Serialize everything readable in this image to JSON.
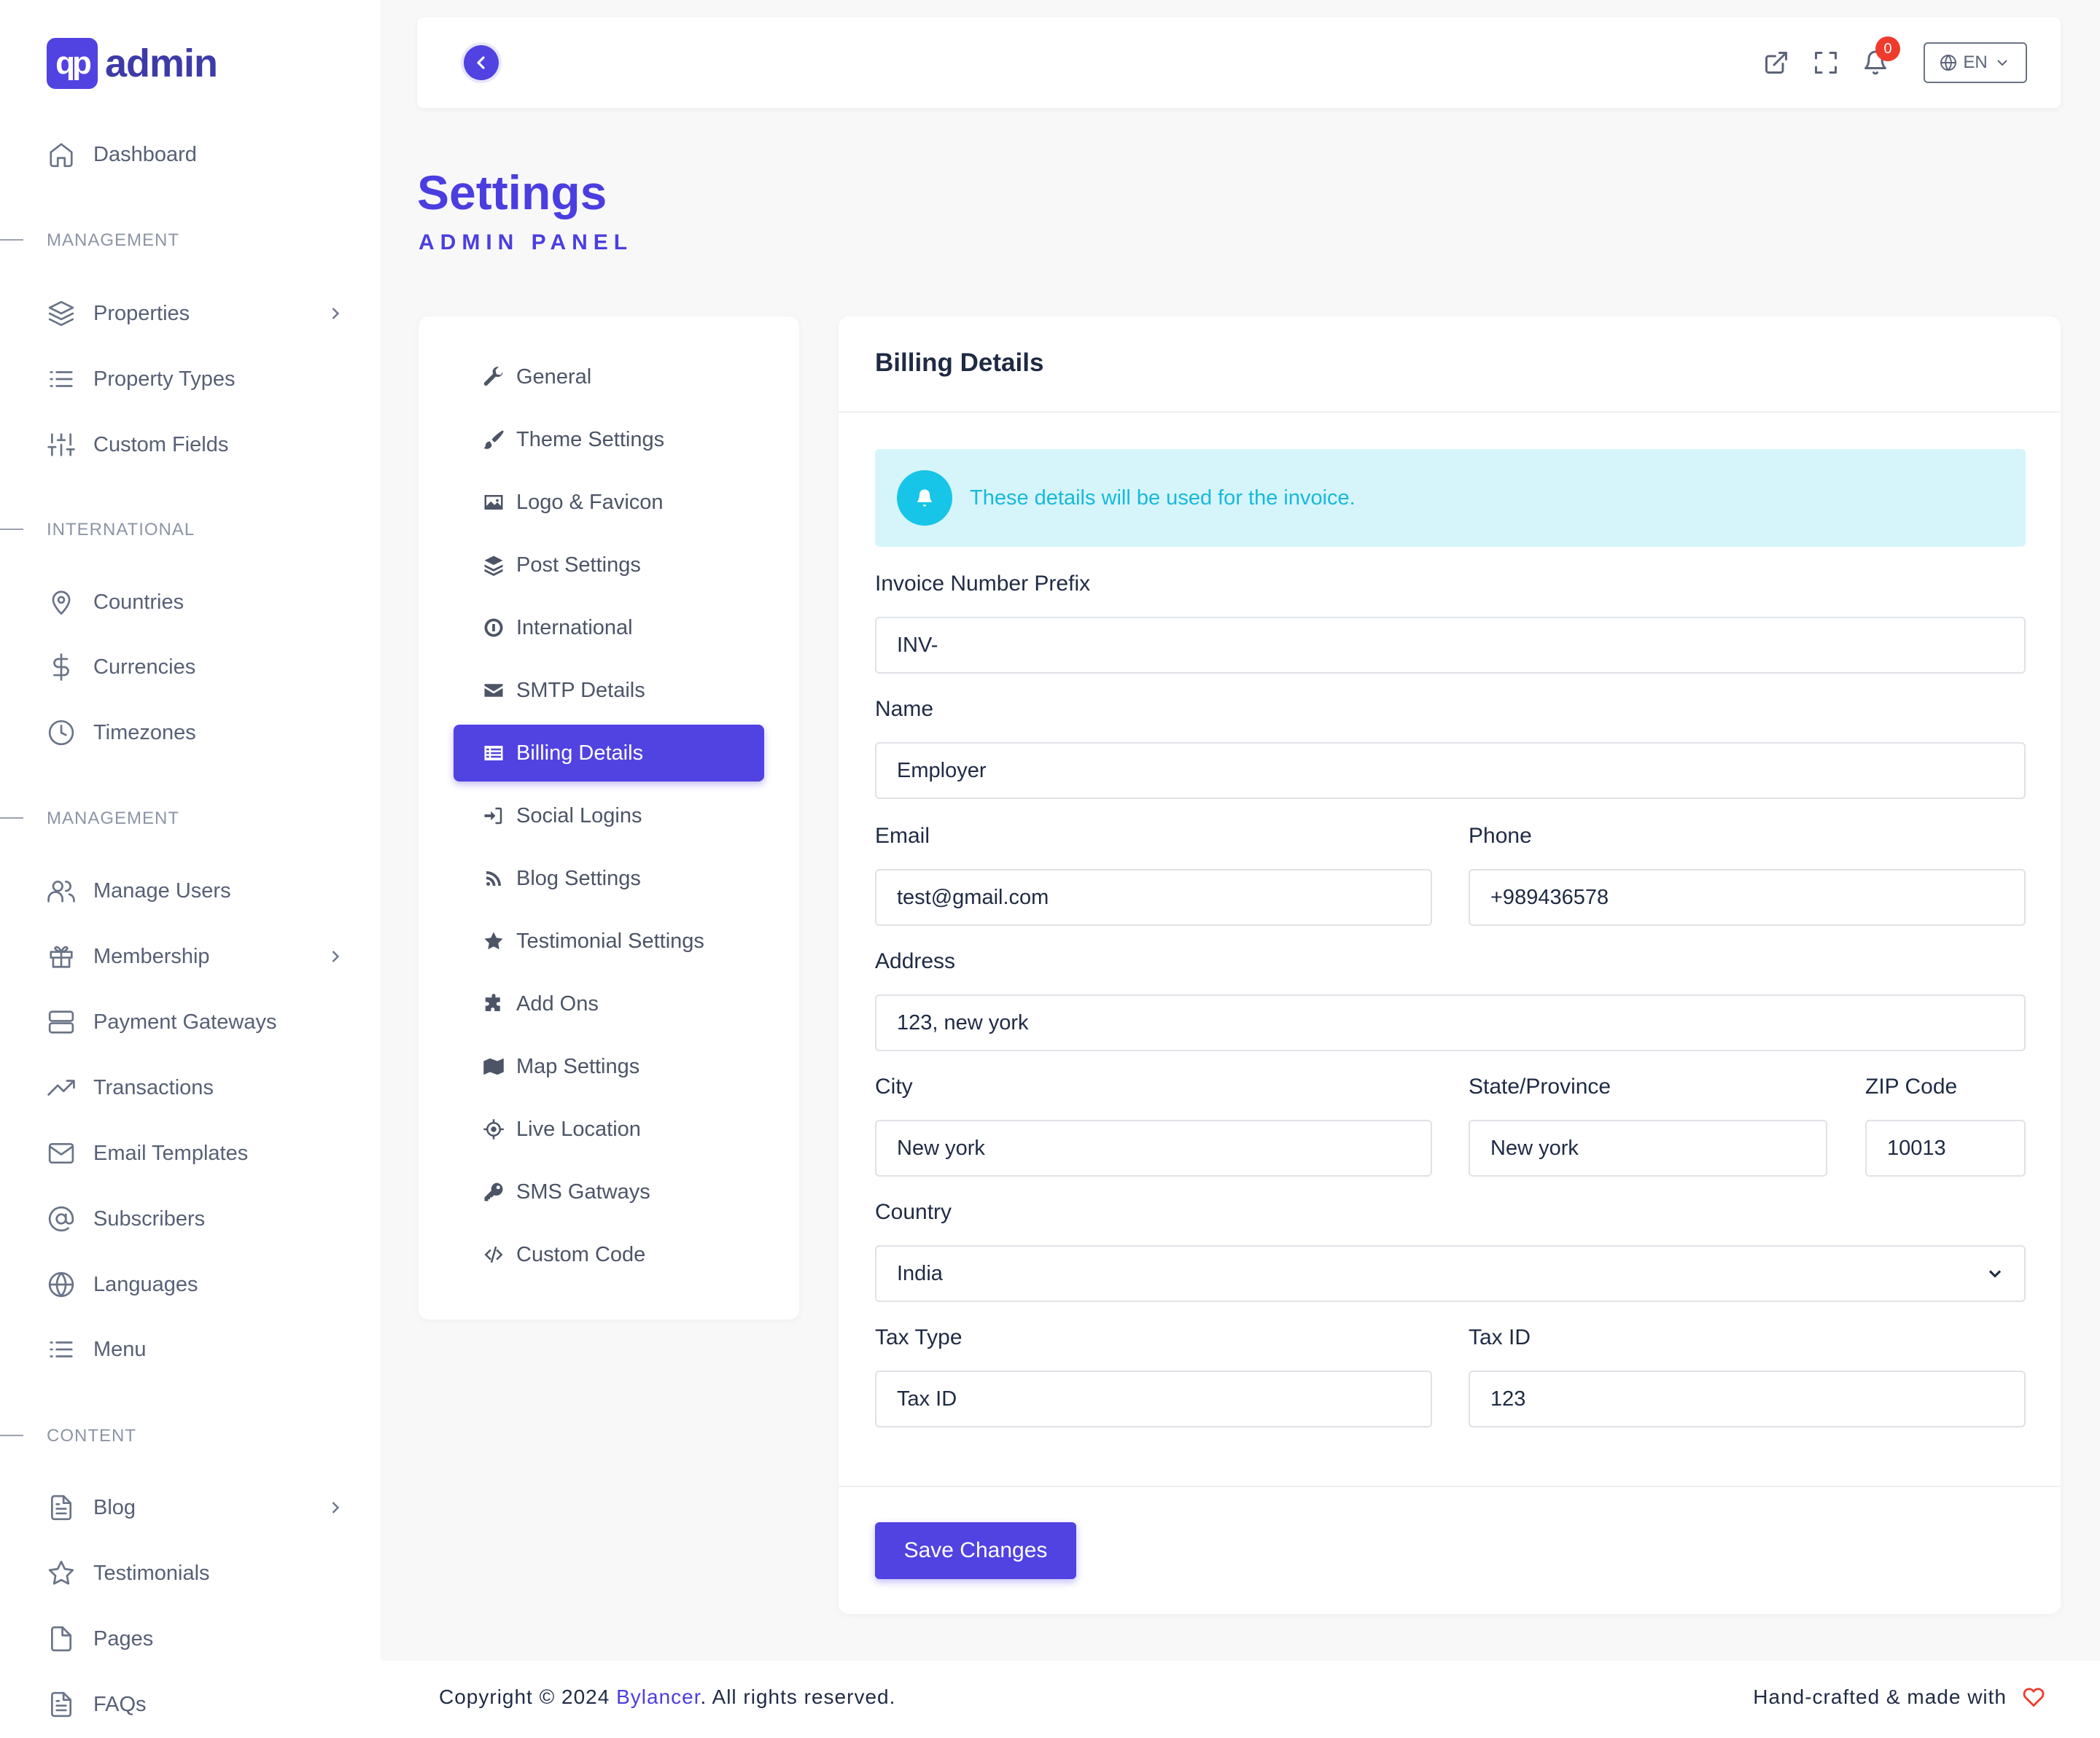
{
  "brand": {
    "mark": "qp",
    "name": "admin"
  },
  "sidebar": {
    "dashboard": "Dashboard",
    "sections": [
      "MANAGEMENT",
      "INTERNATIONAL",
      "MANAGEMENT",
      "CONTENT"
    ],
    "items": [
      {
        "label": "Properties",
        "icon": "layers-icon"
      },
      {
        "label": "Property Types",
        "icon": "list-icon"
      },
      {
        "label": "Custom Fields",
        "icon": "sliders-icon"
      },
      {
        "label": "Countries",
        "icon": "map-pin-icon"
      },
      {
        "label": "Currencies",
        "icon": "dollar-icon"
      },
      {
        "label": "Timezones",
        "icon": "clock-icon"
      },
      {
        "label": "Manage Users",
        "icon": "users-icon"
      },
      {
        "label": "Membership",
        "icon": "gift-icon"
      },
      {
        "label": "Payment Gateways",
        "icon": "server-icon"
      },
      {
        "label": "Transactions",
        "icon": "trending-up-icon"
      },
      {
        "label": "Email Templates",
        "icon": "mail-icon"
      },
      {
        "label": "Subscribers",
        "icon": "at-sign-icon"
      },
      {
        "label": "Languages",
        "icon": "globe-icon"
      },
      {
        "label": "Menu",
        "icon": "list-icon"
      },
      {
        "label": "Blog",
        "icon": "file-text-icon"
      },
      {
        "label": "Testimonials",
        "icon": "star-icon"
      },
      {
        "label": "Pages",
        "icon": "file-icon"
      },
      {
        "label": "FAQs",
        "icon": "file-text-icon"
      }
    ]
  },
  "topbar": {
    "notification_count": "0",
    "language": "EN"
  },
  "page": {
    "title": "Settings",
    "subtitle": "ADMIN PANEL"
  },
  "settings_menu": [
    {
      "label": "General",
      "icon": "wrench-icon"
    },
    {
      "label": "Theme Settings",
      "icon": "brush-icon"
    },
    {
      "label": "Logo & Favicon",
      "icon": "image-icon"
    },
    {
      "label": "Post Settings",
      "icon": "layers-icon"
    },
    {
      "label": "International",
      "icon": "info-circle-icon"
    },
    {
      "label": "SMTP Details",
      "icon": "envelope-icon"
    },
    {
      "label": "Billing Details",
      "icon": "list-alt-icon",
      "active": true
    },
    {
      "label": "Social Logins",
      "icon": "sign-in-icon"
    },
    {
      "label": "Blog Settings",
      "icon": "rss-icon"
    },
    {
      "label": "Testimonial Settings",
      "icon": "star-icon"
    },
    {
      "label": "Add Ons",
      "icon": "puzzle-icon"
    },
    {
      "label": "Map Settings",
      "icon": "map-icon"
    },
    {
      "label": "Live Location",
      "icon": "crosshair-icon"
    },
    {
      "label": "SMS Gatways",
      "icon": "key-icon"
    },
    {
      "label": "Custom Code",
      "icon": "code-icon"
    }
  ],
  "billing": {
    "title": "Billing Details",
    "alert": "These details will be used for the invoice.",
    "fields": {
      "invoice_prefix": {
        "label": "Invoice Number Prefix",
        "value": "INV-"
      },
      "name": {
        "label": "Name",
        "value": "Employer"
      },
      "email": {
        "label": "Email",
        "value": "test@gmail.com"
      },
      "phone": {
        "label": "Phone",
        "value": "+989436578"
      },
      "address": {
        "label": "Address",
        "value": "123, new york"
      },
      "city": {
        "label": "City",
        "value": "New york"
      },
      "state": {
        "label": "State/Province",
        "value": "New york"
      },
      "zip": {
        "label": "ZIP Code",
        "value": "10013"
      },
      "country": {
        "label": "Country",
        "value": "India"
      },
      "tax_type": {
        "label": "Tax Type",
        "value": "Tax ID"
      },
      "tax_id": {
        "label": "Tax ID",
        "value": "123"
      }
    },
    "save_label": "Save Changes"
  },
  "footer": {
    "copyright_prefix": "Copyright © 2024 ",
    "company": "Bylancer",
    "copyright_suffix": ". All rights reserved.",
    "right": "Hand-crafted & made with"
  },
  "colors": {
    "accent": "#5142e2",
    "info": "#16c5e8",
    "info_bg": "#d6f5fb",
    "danger": "#ef3b2d"
  }
}
